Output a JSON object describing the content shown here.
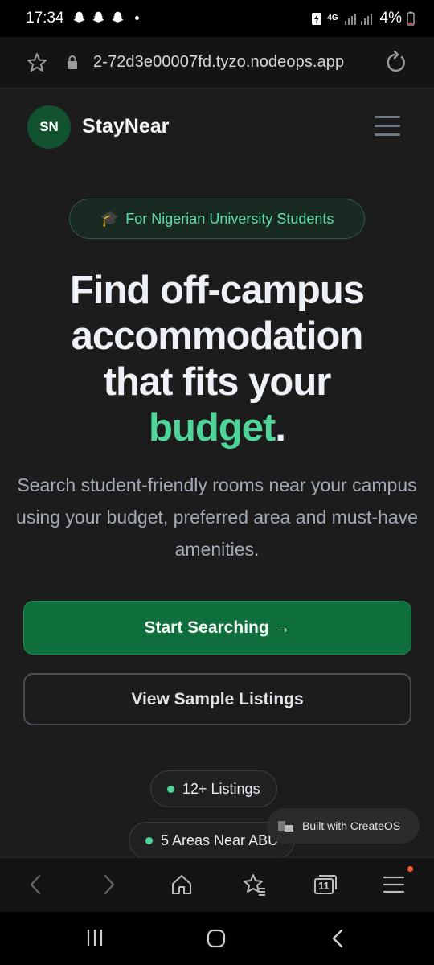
{
  "status_bar": {
    "time": "17:34",
    "network": "4G",
    "battery": "4%",
    "icons": [
      "snapchat-icon",
      "snapchat-icon",
      "snapchat-icon",
      "notification-dot-icon",
      "battery-saver-icon",
      "signal-icon",
      "battery-icon"
    ]
  },
  "browser": {
    "url": "2-72d3e00007fd.tyzo.nodeops.app",
    "tab_count": "11",
    "icons": [
      "star-icon",
      "lock-icon",
      "reload-icon"
    ]
  },
  "site": {
    "logo_initials": "SN",
    "brand": "StayNear"
  },
  "hero": {
    "pill_icon": "🎓",
    "pill_text": "For Nigerian University Students",
    "title_line1": "Find off-campus",
    "title_line2": "accommodation",
    "title_line3": "that fits your",
    "title_accent": "budget",
    "title_period": ".",
    "subtitle": "Search student-friendly rooms near your campus using your budget, preferred area and must-have amenities.",
    "primary_button": "Start Searching →",
    "secondary_button": "View Sample Listings"
  },
  "stats": [
    {
      "label": "12+ Listings"
    },
    {
      "label": "5 Areas Near ABU"
    }
  ],
  "badge": {
    "text": "Built with CreateOS"
  },
  "colors": {
    "accent_green": "#4fd49a",
    "primary_button": "#0f6f3c",
    "logo_bg": "#12522f",
    "page_bg": "#1c1c1d"
  }
}
